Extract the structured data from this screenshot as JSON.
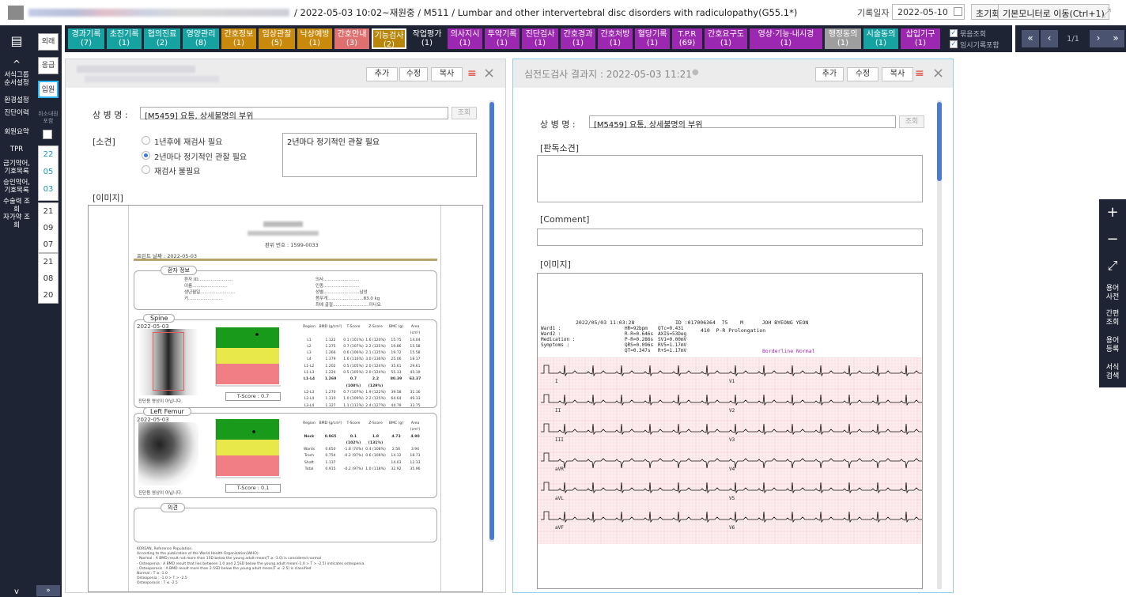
{
  "header": {
    "info_text": "/ 2022-05-03 10:02~재원중 / M511 / Lumbar and other intervertebral disc disorders with radiculopathy(G55.1*)",
    "record_date_label": "기록일자",
    "record_date": "2022-05-10",
    "reset_label": "초기화",
    "monitor_label": "기본모니터로 이동(Ctrl+1)"
  },
  "leftnav": {
    "items": [
      "서식그룹\n순서설정",
      "환경설정",
      "진단이력",
      "회원요약",
      "TPR",
      "금기약어,\n기호목록",
      "승인약어,\n기호목록",
      "수술력 조\n회",
      "자가약 조\n회"
    ]
  },
  "visit_types": [
    "외래",
    "응급",
    "입원"
  ],
  "cancel_include_label": "취소내원\n포함",
  "dates": [
    [
      "22",
      "05",
      "03"
    ],
    [
      "21",
      "09",
      "07"
    ],
    [
      "21",
      "08",
      "20"
    ]
  ],
  "tabs": [
    {
      "label": "경과기록",
      "count": "(7)",
      "color": "#17a2a2"
    },
    {
      "label": "초진기록",
      "count": "(1)",
      "color": "#17a2a2"
    },
    {
      "label": "협의진료",
      "count": "(2)",
      "color": "#17a2a2"
    },
    {
      "label": "영양관리",
      "count": "(8)",
      "color": "#17a2a2"
    },
    {
      "label": "간호정보",
      "count": "(1)",
      "color": "#c98a0c"
    },
    {
      "label": "임상관찰",
      "count": "(5)",
      "color": "#c98a0c"
    },
    {
      "label": "낙상예방",
      "count": "(1)",
      "color": "#c98a0c"
    },
    {
      "label": "간호안내",
      "count": "(3)",
      "color": "#e06f6f"
    },
    {
      "label": "기능검사",
      "count": "(2)",
      "color": "#b7860b"
    },
    {
      "label": "작업평가",
      "count": "(1)",
      "color": "#1e2433"
    },
    {
      "label": "의사지시",
      "count": "(1)",
      "color": "#9c27b0"
    },
    {
      "label": "투약기록",
      "count": "(1)",
      "color": "#9c27b0"
    },
    {
      "label": "진단검사",
      "count": "(1)",
      "color": "#9c27b0"
    },
    {
      "label": "간호경과",
      "count": "(1)",
      "color": "#9c27b0"
    },
    {
      "label": "간호처방",
      "count": "(1)",
      "color": "#9c27b0"
    },
    {
      "label": "혈당기록",
      "count": "(1)",
      "color": "#9c27b0"
    },
    {
      "label": "T.P.R",
      "count": "(69)",
      "color": "#9c27b0"
    },
    {
      "label": "간호요구도",
      "count": "(1)",
      "color": "#9c27b0"
    },
    {
      "label": "영상·기능·내시경",
      "count": "(1)",
      "color": "#9c27b0"
    },
    {
      "label": "행정동의",
      "count": "(1)",
      "color": "#9e9e9e"
    },
    {
      "label": "시술동의",
      "count": "(1)",
      "color": "#17a2a2"
    },
    {
      "label": "삽입기구",
      "count": "(1)",
      "color": "#9c27b0"
    }
  ],
  "checks": [
    "묶음조회",
    "임시기록포함"
  ],
  "pager": {
    "first": "«",
    "prev": "‹",
    "page": "1/1",
    "next": "›",
    "last": "»"
  },
  "panel_buttons": {
    "add": "추가",
    "edit": "수정",
    "copy": "복사"
  },
  "left_panel": {
    "diagnosis_label": "상 병 명 :",
    "diagnosis_value": "[M5459] 요통, 상세불명의 부위",
    "lookup_label": "조회",
    "finding_label": "[소견]",
    "radio_options": [
      "1년후에 재검사 필요",
      "2년마다 정기적인 관찰 필요",
      "재검사 불필요"
    ],
    "selected_radio": 1,
    "finding_text": "2년마다 정기적인 관찰 필요",
    "image_label": "[이미지]"
  },
  "bmd_report": {
    "serial": "판위 번호 : 1599-0033",
    "print_date": "프린트 날짜 : 2022-05-03",
    "patient_info_title": "환자 정보",
    "info_left": [
      "환자 ID",
      "이름",
      "생년월일",
      "키"
    ],
    "info_right": [
      "의사",
      "인종",
      "성별",
      "몸무게",
      "최애 골절"
    ],
    "info_right_values": [
      "",
      "",
      "남성",
      "83.0 kg",
      "아니요"
    ],
    "spine_title": "Spine",
    "spine_date": "2022-05-03",
    "spine_columns": [
      "Region",
      "BMD (g/cm²)",
      "T-Score",
      "Z-Score",
      "BMC (g)",
      "Area (cm²)"
    ],
    "spine_rows": [
      [
        "L1",
        "1.122",
        "0.1 (101%)",
        "1.6 (120%)",
        "15.75",
        "14.04"
      ],
      [
        "L2",
        "1.275",
        "0.7 (107%)",
        "2.2 (125%)",
        "19.86",
        "15.58"
      ],
      [
        "L3",
        "1.266",
        "0.6 (106%)",
        "2.1 (125%)",
        "19.72",
        "15.58"
      ],
      [
        "L4",
        "1.379",
        "1.6 (116%)",
        "3.0 (136%)",
        "25.06",
        "18.17"
      ],
      [
        "L1-L2",
        "1.202",
        "0.5 (105%)",
        "2.0 (124%)",
        "35.61",
        "29.61"
      ],
      [
        "L1-L3",
        "1.224",
        "0.5 (105%)",
        "2.0 (124%)",
        "55.33",
        "45.19"
      ],
      [
        "L1-L4",
        "1.269",
        "0.7 (108%)",
        "2.2 (129%)",
        "80.39",
        "63.37"
      ],
      [
        "L2-L3",
        "1.270",
        "0.7 (107%)",
        "1.9 (122%)",
        "39.58",
        "31.16"
      ],
      [
        "L2-L4",
        "1.310",
        "1.0 (109%)",
        "2.2 (125%)",
        "64.64",
        "49.33"
      ],
      [
        "L3-L4",
        "1.327",
        "1.1 (111%)",
        "2.4 (127%)",
        "44.79",
        "33.75"
      ]
    ],
    "spine_tscore": "T-Score : 0.7",
    "femur_title": "Left Femur",
    "femur_date": "2022-05-03",
    "femur_columns": [
      "Region",
      "BMD (g/cm²)",
      "T-Score",
      "Z-Score",
      "BMC (g)",
      "Area (cm²)"
    ],
    "femur_rows": [
      [
        "Neck",
        "0.965",
        "0.1 (102%)",
        "1.8 (131%)",
        "4.73",
        "4.90"
      ],
      [
        "Wards",
        "0.650",
        "-1.8 (74%)",
        "0.4 (108%)",
        "2.56",
        "3.94"
      ],
      [
        "Troch",
        "0.754",
        "-0.2 (97%)",
        "0.6 (106%)",
        "14.12",
        "18.73"
      ],
      [
        "Shaft",
        "1.137",
        "-",
        "-",
        "14.03",
        "12.33"
      ],
      [
        "Total",
        "0.915",
        "-0.2 (97%)",
        "1.0 (118%)",
        "32.92",
        "35.96"
      ]
    ],
    "femur_tscore": "T-Score : 0.1",
    "not_diagnostic": "진단용 영상이 아닙니다.",
    "opinion_title": "의견",
    "footer_lines": [
      "KOREAN, Reference Population.",
      "According to the publication of the World Health Organization(WHO):",
      "- Normal : A BMD result not more than 1SD below the young adult mean(T ≥ -1.0) is considered normal",
      "- Osteopenia : A BMD result that lies between 1.0 and 2.5SD below the young adult mean(-1.0 > T > -2.5) indicates osteopenia.",
      "- Osteoporosis : A BMD result more than 2.5SD below the young adult mean(T ≤ -2.5) is classified",
      "Normal : T ≥ -1.0",
      "Osteopenia : -1.0 > T > -2.5",
      "Osteoporosis : T ≤ -2.5"
    ]
  },
  "right_panel": {
    "title": "심전도검사 결과지 : 2022-05-03 11:21",
    "diagnosis_label": "상 병 명 :",
    "diagnosis_value": "[M5459] 요통, 상세불명의 부위",
    "lookup_label": "조회",
    "reading_label": "[판독소견]",
    "comment_label": "[Comment]",
    "image_label": "[이미지]"
  },
  "ecg": {
    "datetime": "2022/05/03 11:03:28",
    "id_line": "ID :017006364  75    M      JOH BYEONG YEON",
    "ward1": "Ward1 :",
    "ward2": "Ward2 :",
    "medication": "Medication :",
    "symptoms": "Symptoms :",
    "vals1": [
      "HR=92bpm",
      "R-R=0.646s",
      "P-R=0.286s",
      "QRS=0.096s",
      "QT=0.347s"
    ],
    "vals2": [
      "QTc=0.431",
      "AXIS=53Deg",
      "SV1=0.00mV",
      "RV5=1.17mV",
      "R+S=1.17mV"
    ],
    "code": "410  P-R Prolongation",
    "interpretation": "Borderline Normal",
    "leads_left": [
      "I",
      "II",
      "III",
      "aVR",
      "aVL",
      "aVF"
    ],
    "leads_right": [
      "V1",
      "V2",
      "V3",
      "V4",
      "V5",
      "V6"
    ]
  },
  "float_tools": [
    "+",
    "−",
    "⤢",
    "용어\n사전",
    "간편\n조회",
    "용어\n등록",
    "서식\n검색"
  ],
  "colors": {
    "accent_blue": "#3a7bd5",
    "nav_bg": "#1e2433",
    "ecg_grid": "#f5b6c0",
    "ecg_text": "#9c27b0"
  }
}
